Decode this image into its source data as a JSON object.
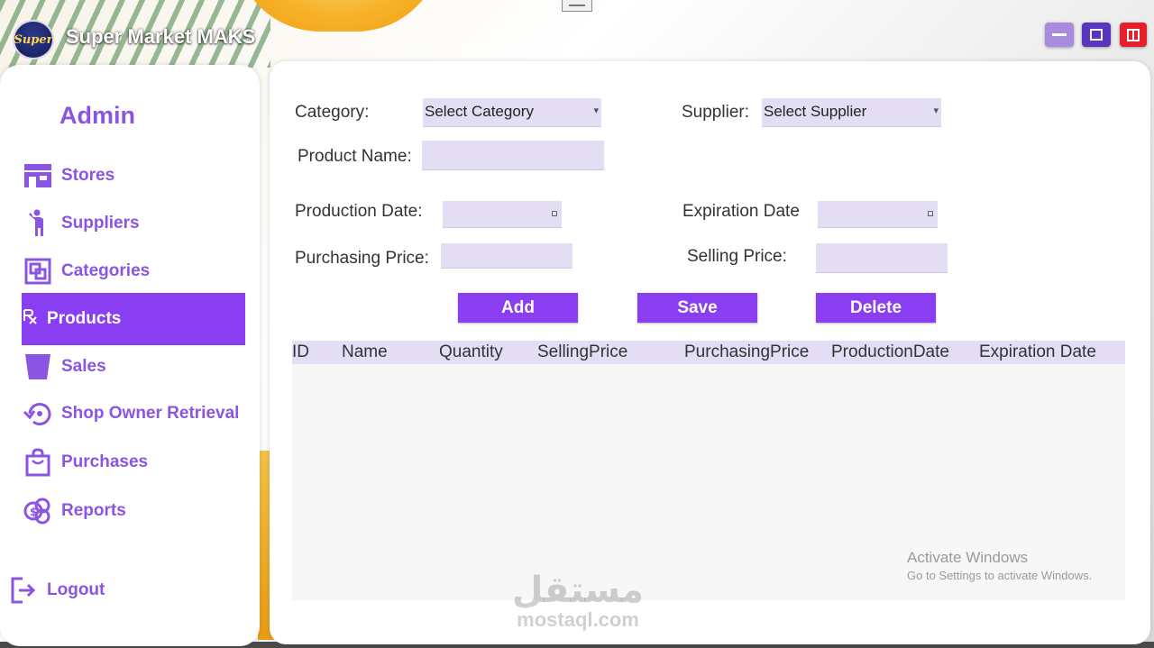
{
  "app": {
    "title": "Super Market MAKS",
    "logo_text": "Super"
  },
  "window_controls": {
    "minimize": "minimize-icon",
    "maximize": "maximize-icon",
    "close": "exit-icon"
  },
  "sidebar": {
    "heading": "Admin",
    "items": [
      {
        "label": "Stores",
        "icon": "store-icon"
      },
      {
        "label": "Suppliers",
        "icon": "person-icon"
      },
      {
        "label": "Categories",
        "icon": "categories-icon"
      },
      {
        "label": "Products",
        "icon": "prescription-icon",
        "active": true
      },
      {
        "label": "Sales",
        "icon": "bucket-icon"
      },
      {
        "label": "Shop Owner Retrieval",
        "icon": "restore-icon"
      },
      {
        "label": "Purchases",
        "icon": "shopping-bag-icon"
      },
      {
        "label": "Reports",
        "icon": "reports-icon"
      }
    ],
    "logout": {
      "label": "Logout",
      "icon": "logout-icon"
    }
  },
  "form": {
    "category_label": "Category:",
    "category_value": "Select Category",
    "supplier_label": "Supplier:",
    "supplier_value": "Select Supplier",
    "product_name_label": "Product Name:",
    "product_name_value": "",
    "production_date_label": "Production Date:",
    "expiration_date_label": "Expiration Date",
    "purchasing_price_label": "Purchasing Price:",
    "selling_price_label": "Selling Price:"
  },
  "buttons": {
    "add": "Add",
    "save": "Save",
    "delete": "Delete"
  },
  "grid": {
    "columns": [
      "ID",
      "Name",
      "Quantity",
      "SellingPrice",
      "PurchasingPrice",
      "ProductionDate",
      "Expiration Date"
    ],
    "rows": []
  },
  "watermark": {
    "line1": "Activate Windows",
    "line2": "Go to Settings to activate Windows."
  },
  "site_mark": {
    "arabic": "مستقل",
    "latin": "mostaql.com"
  },
  "colors": {
    "accent": "#8a3ef2",
    "accent_text": "#8a55e2",
    "field_bg": "#e4def5",
    "close_button": "#e3202b"
  }
}
